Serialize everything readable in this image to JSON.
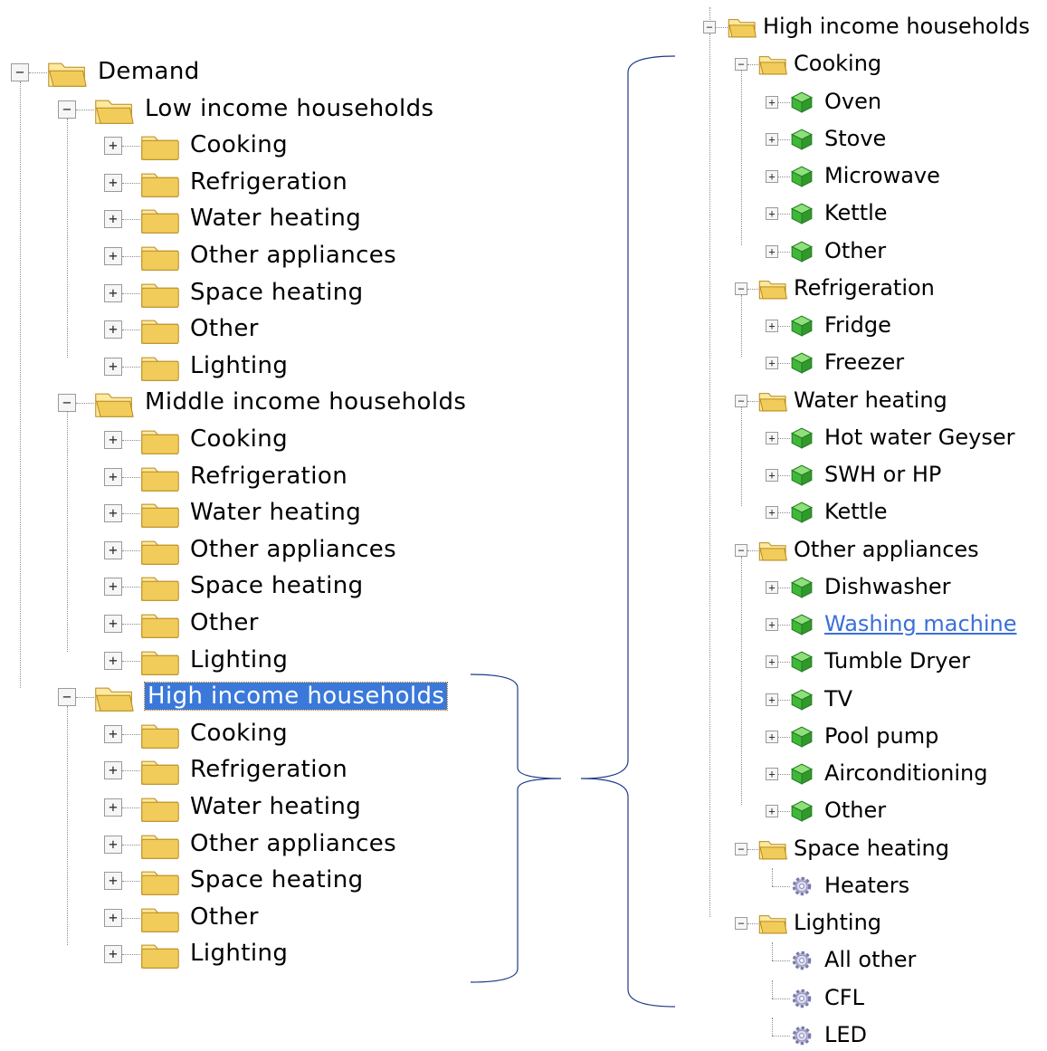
{
  "left_tree": {
    "root": "Demand",
    "groups": [
      {
        "label": "Low income households",
        "selected": false,
        "children": [
          "Cooking",
          "Refrigeration",
          "Water heating",
          "Other appliances",
          "Space heating",
          "Other",
          "Lighting"
        ]
      },
      {
        "label": "Middle income households",
        "selected": false,
        "children": [
          "Cooking",
          "Refrigeration",
          "Water heating",
          "Other appliances",
          "Space heating",
          "Other",
          "Lighting"
        ]
      },
      {
        "label": "High income households",
        "selected": true,
        "children": [
          "Cooking",
          "Refrigeration",
          "Water heating",
          "Other appliances",
          "Space heating",
          "Other",
          "Lighting"
        ]
      }
    ]
  },
  "right_tree": {
    "root": "High income households",
    "categories": [
      {
        "label": "Cooking",
        "items": [
          {
            "label": "Oven",
            "icon": "green-cube-icon"
          },
          {
            "label": "Stove",
            "icon": "green-cube-icon"
          },
          {
            "label": "Microwave",
            "icon": "green-cube-icon"
          },
          {
            "label": "Kettle",
            "icon": "green-cube-icon"
          },
          {
            "label": "Other",
            "icon": "green-cube-icon"
          }
        ]
      },
      {
        "label": "Refrigeration",
        "items": [
          {
            "label": "Fridge",
            "icon": "green-cube-icon"
          },
          {
            "label": "Freezer",
            "icon": "green-cube-icon"
          }
        ]
      },
      {
        "label": "Water heating",
        "items": [
          {
            "label": "Hot water Geyser",
            "icon": "green-cube-icon"
          },
          {
            "label": "SWH or HP",
            "icon": "green-cube-icon"
          },
          {
            "label": "Kettle",
            "icon": "green-cube-icon"
          }
        ]
      },
      {
        "label": "Other appliances",
        "items": [
          {
            "label": "Dishwasher",
            "icon": "green-cube-icon"
          },
          {
            "label": "Washing machine",
            "icon": "green-cube-icon",
            "link": true
          },
          {
            "label": "Tumble Dryer",
            "icon": "green-cube-icon"
          },
          {
            "label": "TV",
            "icon": "green-cube-icon"
          },
          {
            "label": "Pool pump",
            "icon": "green-cube-icon"
          },
          {
            "label": "Airconditioning",
            "icon": "green-cube-icon"
          },
          {
            "label": "Other",
            "icon": "green-cube-icon"
          }
        ]
      },
      {
        "label": "Space heating",
        "items": [
          {
            "label": "Heaters",
            "icon": "gear-icon"
          }
        ]
      },
      {
        "label": "Lighting",
        "items": [
          {
            "label": "All other",
            "icon": "gear-icon"
          },
          {
            "label": "CFL",
            "icon": "gear-icon"
          },
          {
            "label": "LED",
            "icon": "gear-icon"
          }
        ]
      }
    ]
  },
  "colors": {
    "folder": "#f2cc5a",
    "folder_dark": "#b88a1c",
    "cube": "#3fb83a",
    "selection": "#3a79d9",
    "link": "#3a6fd8",
    "brace": "#1e3a8a"
  },
  "toggles": {
    "expanded": "−",
    "collapsed": "+"
  }
}
